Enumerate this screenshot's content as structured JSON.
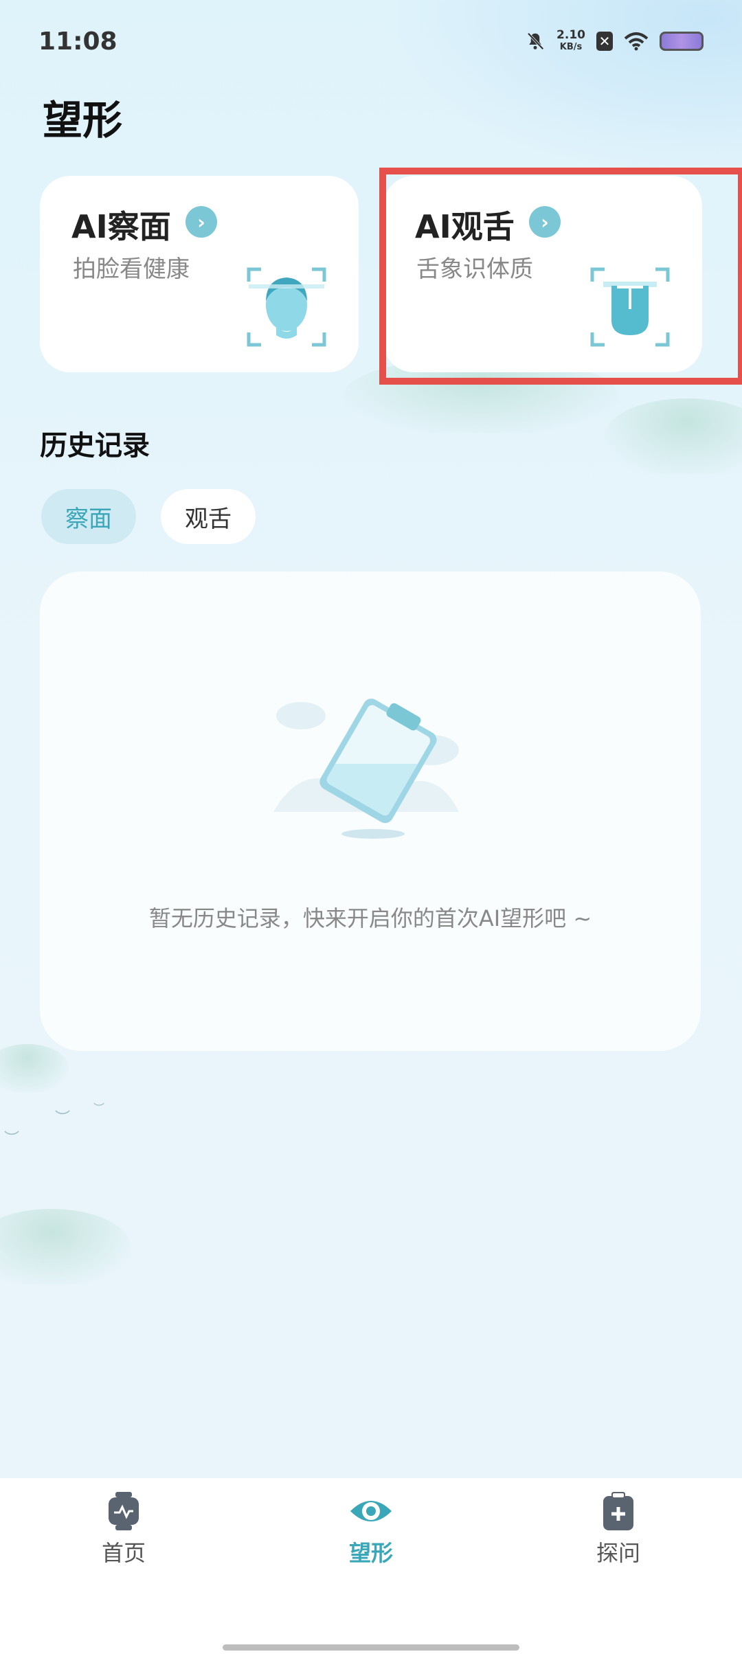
{
  "status_bar": {
    "time": "11:08",
    "speed_value": "2.10",
    "speed_unit": "KB/s",
    "icons": [
      "bell-off-icon",
      "notification-x-icon",
      "wifi-icon",
      "battery-icon"
    ]
  },
  "page": {
    "title": "望形"
  },
  "cards": [
    {
      "title": "AI察面",
      "subtitle": "拍脸看健康",
      "icon": "face-scan-icon"
    },
    {
      "title": "AI观舌",
      "subtitle": "舌象识体质",
      "icon": "tongue-scan-icon"
    }
  ],
  "history": {
    "title": "历史记录",
    "tabs": [
      {
        "label": "察面",
        "active": true
      },
      {
        "label": "观舌",
        "active": false
      }
    ],
    "empty_text": "暂无历史记录，快来开启你的首次AI望形吧 ~"
  },
  "tabbar": {
    "items": [
      {
        "label": "首页",
        "icon": "watch-icon",
        "active": false
      },
      {
        "label": "望形",
        "icon": "eye-icon",
        "active": true
      },
      {
        "label": "探问",
        "icon": "clipboard-plus-icon",
        "active": false
      }
    ]
  },
  "colors": {
    "accent": "#3aa7b8",
    "highlight": "#e5504a"
  }
}
